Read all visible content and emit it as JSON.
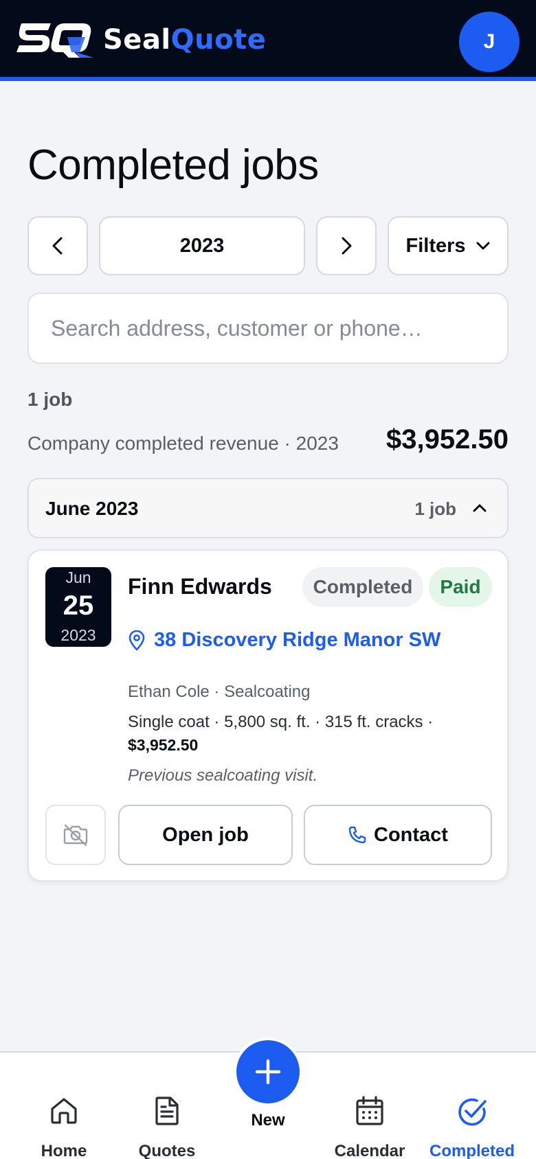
{
  "brand": {
    "name_part1": "Seal",
    "name_part2": "Quote",
    "mark": "SQ",
    "accent": "#1d5cf0"
  },
  "user": {
    "avatar_initial": "J"
  },
  "page": {
    "title": "Completed jobs"
  },
  "controls": {
    "prev_icon": "chevron-left-icon",
    "year": "2023",
    "next_icon": "chevron-right-icon",
    "filters_label": "Filters"
  },
  "search": {
    "placeholder": "Search address, customer or phone…",
    "value": ""
  },
  "summary": {
    "job_count": "1 job",
    "revenue_label": "Company completed revenue · 2023",
    "revenue_value": "$3,952.50"
  },
  "groups": [
    {
      "month": "June 2023",
      "count": "1 job",
      "expanded": true,
      "jobs": [
        {
          "date": {
            "month": "Jun",
            "day": "25",
            "year": "2023"
          },
          "customer": "Finn Edwards",
          "status": "Completed",
          "payment": "Paid",
          "address": "38 Discovery Ridge Manor SW",
          "assignee_line": "Ethan Cole · Sealcoating",
          "specs": "Single coat · 5,800 sq. ft. · 315 ft. cracks ·",
          "price": "$3,952.50",
          "note": "Previous sealcoating visit.",
          "open_label": "Open job",
          "contact_label": "Contact"
        }
      ]
    }
  ],
  "nav": {
    "home": "Home",
    "quotes": "Quotes",
    "new": "New",
    "calendar": "Calendar",
    "completed": "Completed",
    "active": "completed"
  }
}
